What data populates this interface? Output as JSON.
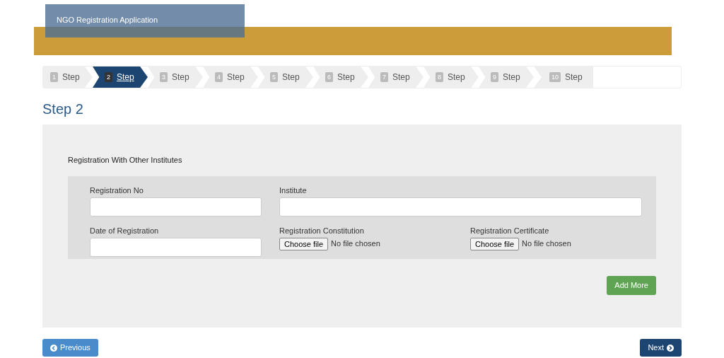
{
  "header": {
    "title": "NGO Registration Application"
  },
  "steps": [
    {
      "number": "1",
      "label": "Step",
      "selected": false
    },
    {
      "number": "2",
      "label": "Step",
      "selected": true
    },
    {
      "number": "3",
      "label": "Step",
      "selected": false
    },
    {
      "number": "4",
      "label": "Step",
      "selected": false
    },
    {
      "number": "5",
      "label": "Step",
      "selected": false
    },
    {
      "number": "6",
      "label": "Step",
      "selected": false
    },
    {
      "number": "7",
      "label": "Step",
      "selected": false
    },
    {
      "number": "8",
      "label": "Step",
      "selected": false
    },
    {
      "number": "9",
      "label": "Step",
      "selected": false
    },
    {
      "number": "10",
      "label": "Step",
      "selected": false
    }
  ],
  "heading": "Step 2",
  "section": {
    "title": "Registration With Other Institutes",
    "fields": [
      {
        "kind": "text",
        "label": "Registration No"
      },
      {
        "kind": "text",
        "label": "Institute"
      },
      {
        "kind": "text",
        "label": "Date of Registration"
      },
      {
        "kind": "file",
        "label": "Registration Constitution",
        "button": "Choose file",
        "status": "No file chosen"
      },
      {
        "kind": "file",
        "label": "Registration Certificate",
        "button": "Choose file",
        "status": "No file chosen"
      }
    ],
    "add_button": "Add More"
  },
  "nav": {
    "previous": "Previous",
    "next": "Next"
  }
}
